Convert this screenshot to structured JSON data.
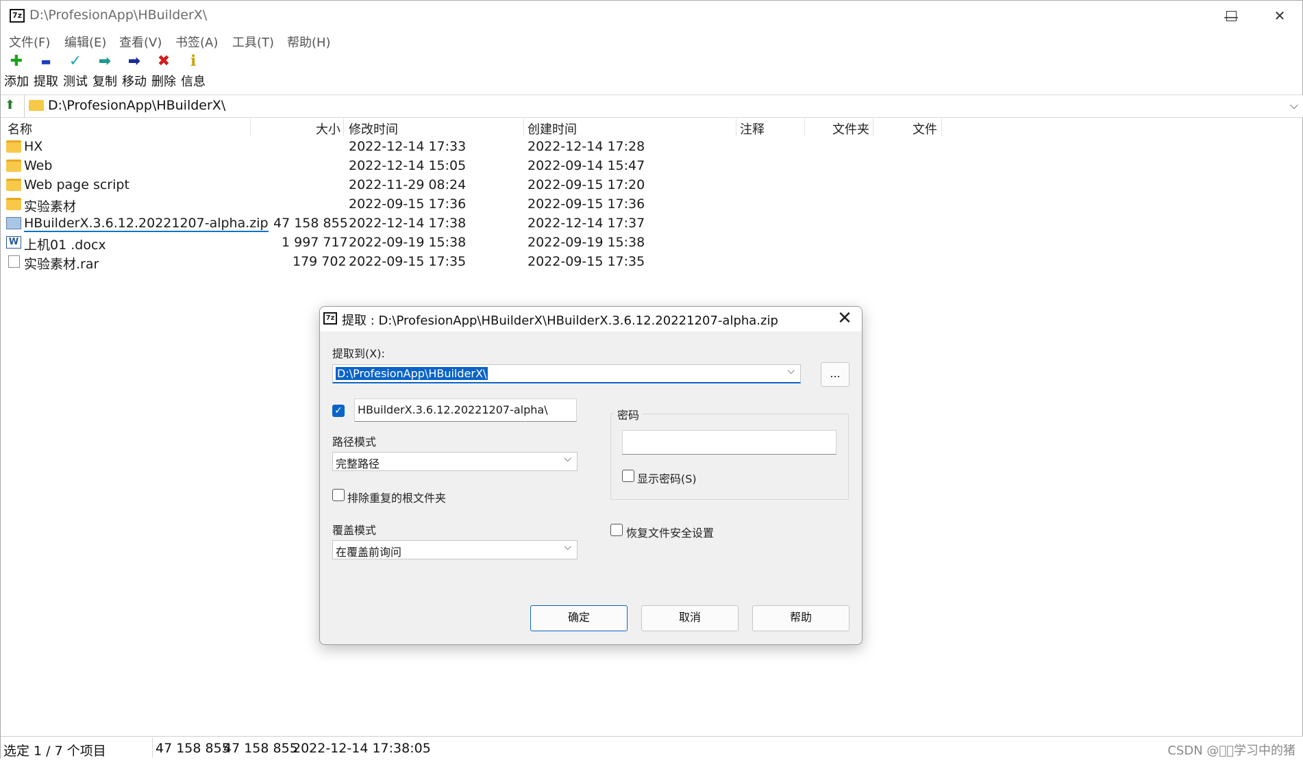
{
  "window": {
    "title": "D:\\ProfesionApp\\HBuilderX\\",
    "app_icon": "7z"
  },
  "menu": [
    "文件(F)",
    "编辑(E)",
    "查看(V)",
    "书签(A)",
    "工具(T)",
    "帮助(H)"
  ],
  "toolbar": [
    {
      "label": "添加",
      "icon": "add-icon",
      "glyph": "✚",
      "color": "#1aa31a"
    },
    {
      "label": "提取",
      "icon": "extract-icon",
      "glyph": "▬",
      "color": "#1a3fbf"
    },
    {
      "label": "测试",
      "icon": "test-icon",
      "glyph": "✓",
      "color": "#1aa8b8"
    },
    {
      "label": "复制",
      "icon": "copy-icon",
      "glyph": "➡",
      "color": "#1a9a8a"
    },
    {
      "label": "移动",
      "icon": "move-icon",
      "glyph": "➡",
      "color": "#1a2a9a"
    },
    {
      "label": "删除",
      "icon": "delete-icon",
      "glyph": "✖",
      "color": "#d41a1a"
    },
    {
      "label": "信息",
      "icon": "info-icon",
      "glyph": "ℹ",
      "color": "#c8a200"
    }
  ],
  "address": "D:\\ProfesionApp\\HBuilderX\\",
  "columns": {
    "name": "名称",
    "size": "大小",
    "modified": "修改时间",
    "created": "创建时间",
    "comment": "注释",
    "folders": "文件夹",
    "files": "文件"
  },
  "files": [
    {
      "name": "HX",
      "type": "folder",
      "size": "",
      "modified": "2022-12-14 17:33",
      "created": "2022-12-14 17:28"
    },
    {
      "name": "Web",
      "type": "folder",
      "size": "",
      "modified": "2022-12-14 15:05",
      "created": "2022-09-14 15:47"
    },
    {
      "name": "Web page script",
      "type": "folder",
      "size": "",
      "modified": "2022-11-29 08:24",
      "created": "2022-09-15 17:20"
    },
    {
      "name": "实验素材",
      "type": "folder",
      "size": "",
      "modified": "2022-09-15 17:36",
      "created": "2022-09-15 17:36"
    },
    {
      "name": "HBuilderX.3.6.12.20221207-alpha.zip",
      "type": "zip",
      "size": "47 158 855",
      "modified": "2022-12-14 17:38",
      "created": "2022-12-14 17:37",
      "selected": true
    },
    {
      "name": "上机01 .docx",
      "type": "docx",
      "size": "1 997 717",
      "modified": "2022-09-19 15:38",
      "created": "2022-09-19 15:38"
    },
    {
      "name": "实验素材.rar",
      "type": "file",
      "size": "179 702",
      "modified": "2022-09-15 17:35",
      "created": "2022-09-15 17:35"
    }
  ],
  "status": {
    "selection": "选定 1 / 7 个项目",
    "size1": "47 158 855",
    "size2": "47 158 855",
    "datetime": "2022-12-14 17:38:05",
    "watermark": "CSDN @\u0000\u0000学习中的猪"
  },
  "dialog": {
    "title": "提取 : D:\\ProfesionApp\\HBuilderX\\HBuilderX.3.6.12.20221207-alpha.zip",
    "extract_to_label": "提取到(X):",
    "extract_to_value": "D:\\ProfesionApp\\HBuilderX\\",
    "browse_label": "...",
    "subfolder_checked": true,
    "subfolder_value": "HBuilderX.3.6.12.20221207-alpha\\",
    "path_mode_label": "路径模式",
    "path_mode_value": "完整路径",
    "eliminate_dup_label": "排除重复的根文件夹",
    "eliminate_dup_checked": false,
    "overwrite_label": "覆盖模式",
    "overwrite_value": "在覆盖前询问",
    "password_label": "密码",
    "password_value": "",
    "show_password_label": "显示密码(S)",
    "show_password_checked": false,
    "restore_security_label": "恢复文件安全设置",
    "restore_security_checked": false,
    "ok_label": "确定",
    "cancel_label": "取消",
    "help_label": "帮助"
  }
}
